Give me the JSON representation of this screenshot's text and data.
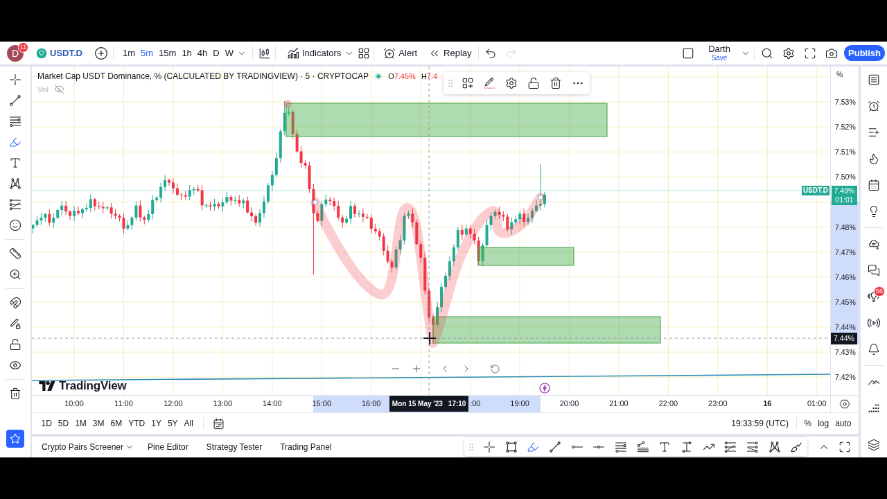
{
  "top_bar": {
    "avatar": {
      "letter": "D",
      "badge": "11"
    },
    "symbol": "USDT.D",
    "intervals": [
      {
        "label": "1m",
        "selected": false
      },
      {
        "label": "5m",
        "selected": true
      },
      {
        "label": "15m",
        "selected": false
      },
      {
        "label": "1h",
        "selected": false
      },
      {
        "label": "4h",
        "selected": false
      },
      {
        "label": "D",
        "selected": false
      },
      {
        "label": "W",
        "selected": false
      }
    ],
    "indicators": "Indicators",
    "alert": "Alert",
    "replay": "Replay",
    "redo_disabled": true,
    "layout": {
      "name": "Darth",
      "status": "Save"
    },
    "publish": "Publish"
  },
  "left_toolbar": {
    "tools": [
      {
        "selected": false
      },
      {
        "selected": false
      },
      {
        "selected": false
      },
      {
        "selected": true
      },
      {
        "selected": false
      },
      {
        "selected": false
      },
      {
        "selected": false
      },
      {
        "selected": false
      }
    ]
  },
  "chart": {
    "legend": {
      "title": "Market Cap USDT Dominance, % (CALCULATED BY TRADINGVIEW) · 5 · CRYPTOCAP",
      "values": [
        {
          "label": "O",
          "value": "7.45%"
        },
        {
          "label": "H",
          "value": "7.4"
        }
      ],
      "volume": {
        "label": "Vol",
        "hidden": true
      }
    },
    "logo": "TradingView",
    "price_axis": {
      "unit": "%",
      "levels": [
        {
          "kind": "tick",
          "label": "7.53%"
        },
        {
          "kind": "tick",
          "label": "7.52%"
        },
        {
          "kind": "tick",
          "label": "7.51%"
        },
        {
          "kind": "tick",
          "label": "7.50%"
        },
        {
          "kind": "last_price",
          "label": "7.49%",
          "symbol": "USDT.D",
          "countdown": "01:01"
        },
        {
          "kind": "tick",
          "label": "7.48%"
        },
        {
          "kind": "tick",
          "label": "7.47%"
        },
        {
          "kind": "tick",
          "label": "7.46%"
        },
        {
          "kind": "tick",
          "label": "7.45%"
        },
        {
          "kind": "tick",
          "label": "7.44%"
        },
        {
          "kind": "tick",
          "label": "7.43%"
        },
        {
          "kind": "tick",
          "label": "7.42%"
        }
      ],
      "crosshair_label": "7.44%"
    },
    "time_axis": {
      "labels": [
        {
          "kind": "tick",
          "label": "10:00",
          "bold": false
        },
        {
          "kind": "tick",
          "label": "11:00",
          "bold": false
        },
        {
          "kind": "tick",
          "label": "12:00",
          "bold": false
        },
        {
          "kind": "tick",
          "label": "13:00",
          "bold": false
        },
        {
          "kind": "tick",
          "label": "14:00",
          "bold": false
        },
        {
          "kind": "tick",
          "label": "15:00",
          "bold": false
        },
        {
          "kind": "tick",
          "label": "16:00",
          "bold": false
        },
        {
          "kind": "cursor",
          "date": "Mon 15 May '23",
          "time": "17:10"
        },
        {
          "kind": "tick",
          "label": ":00",
          "bold": false
        },
        {
          "kind": "tick",
          "label": "19:00",
          "bold": false
        },
        {
          "kind": "tick",
          "label": "20:00",
          "bold": false
        },
        {
          "kind": "tick",
          "label": "21:00",
          "bold": false
        },
        {
          "kind": "tick",
          "label": "22:00",
          "bold": false
        },
        {
          "kind": "tick",
          "label": "23:00",
          "bold": false
        },
        {
          "kind": "tick",
          "label": "16",
          "bold": true
        },
        {
          "kind": "tick",
          "label": "01:00",
          "bold": false
        }
      ]
    }
  },
  "range_bar": {
    "ranges": [
      "1D",
      "5D",
      "1M",
      "3M",
      "6M",
      "YTD",
      "1Y",
      "5Y",
      "All"
    ],
    "clock": "19:33:59 (UTC)",
    "scale_modes": [
      "%",
      "log",
      "auto"
    ]
  },
  "bottom_panel": {
    "tabs": [
      {
        "label": "Crypto Pairs Screener",
        "dropdown": true
      },
      {
        "label": "Pine Editor",
        "dropdown": false
      },
      {
        "label": "Strategy Tester",
        "dropdown": false
      },
      {
        "label": "Trading Panel",
        "dropdown": false
      }
    ],
    "drawing_tools": [
      {
        "selected": false
      },
      {
        "selected": false
      },
      {
        "selected": true
      },
      {
        "selected": false
      },
      {
        "selected": false
      },
      {
        "selected": false
      },
      {
        "selected": false
      },
      {
        "selected": false
      },
      {
        "selected": false
      },
      {
        "selected": false
      },
      {
        "selected": false
      },
      {
        "selected": false
      },
      {
        "selected": false
      },
      {
        "selected": false
      },
      {
        "selected": false
      }
    ]
  },
  "right_sidebar": {
    "badge": "56"
  }
}
